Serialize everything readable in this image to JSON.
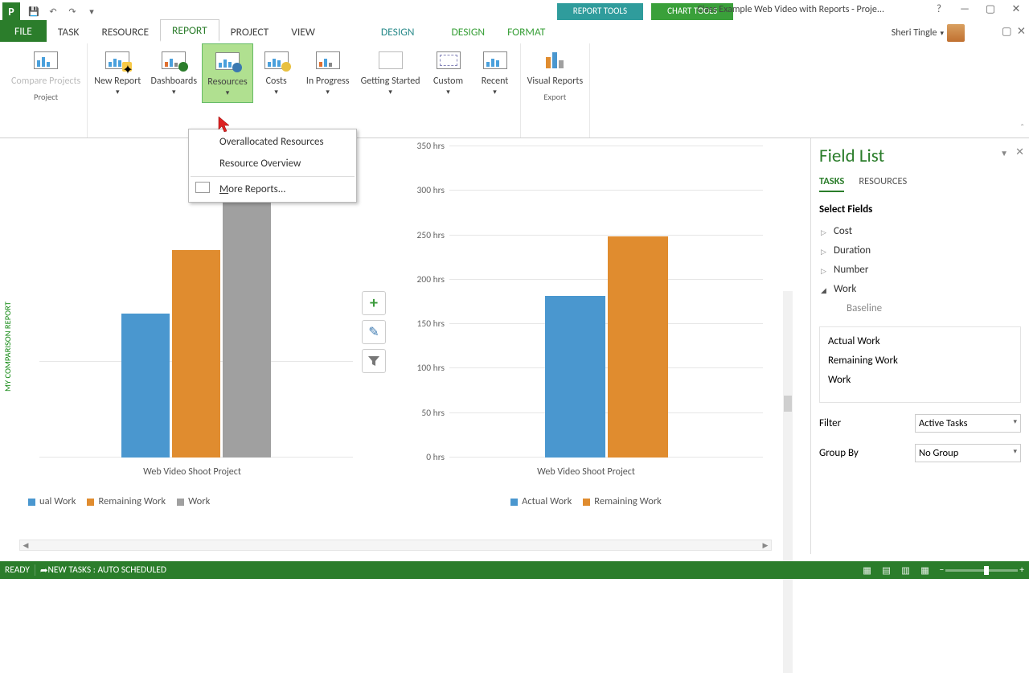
{
  "titlebar": {
    "doc_title": "Class Example Web Video with Reports - Proje...",
    "ctx_report": "REPORT TOOLS",
    "ctx_chart": "CHART TOOLS"
  },
  "tabs": {
    "file": "FILE",
    "task": "TASK",
    "resource": "RESOURCE",
    "report": "REPORT",
    "project": "PROJECT",
    "view": "VIEW",
    "design1": "DESIGN",
    "design2": "DESIGN",
    "format": "FORMAT",
    "user": "Sheri Tingle"
  },
  "ribbon": {
    "compare": "Compare\nProjects",
    "new_report": "New\nReport",
    "dashboards": "Dashboards",
    "resources": "Resources",
    "costs": "Costs",
    "in_progress": "In Progress",
    "getting_started": "Getting\nStarted",
    "custom": "Custom",
    "recent": "Recent",
    "visual": "Visual\nReports",
    "grp_project": "Project",
    "grp_export": "Export"
  },
  "dropdown": {
    "over": "Overallocated Resources",
    "overview": "Resource Overview",
    "more": "More Reports..."
  },
  "chart1": {
    "xaxis": "Web Video Shoot Project",
    "legend": [
      "ual Work",
      "Remaining Work",
      "Work"
    ]
  },
  "chart2": {
    "xaxis": "Web Video Shoot Project",
    "legend": [
      "Actual Work",
      "Remaining Work"
    ],
    "ylabels": [
      "0 hrs",
      "50 hrs",
      "100 hrs",
      "150 hrs",
      "200 hrs",
      "250 hrs",
      "300 hrs",
      "350 hrs"
    ]
  },
  "vtitle": "MY COMPARISON REPORT",
  "panel": {
    "title": "Field List",
    "tab_tasks": "TASKS",
    "tab_res": "RESOURCES",
    "select_fields": "Select Fields",
    "tree": {
      "cost": "Cost",
      "duration": "Duration",
      "number": "Number",
      "work": "Work",
      "baseline": "Baseline"
    },
    "sel": [
      "Actual Work",
      "Remaining Work",
      "Work"
    ],
    "filter_label": "Filter",
    "filter_value": "Active Tasks",
    "group_label": "Group By",
    "group_value": "No Group"
  },
  "status": {
    "ready": "READY",
    "newtasks": "NEW TASKS : AUTO SCHEDULED"
  },
  "chart_data": [
    {
      "type": "bar",
      "title": "",
      "categories": [
        "Web Video Shoot Project"
      ],
      "series": [
        {
          "name": "Actual Work",
          "values": [
            185
          ]
        },
        {
          "name": "Remaining Work",
          "values": [
            250
          ]
        },
        {
          "name": "Work",
          "values": [
            435
          ]
        }
      ],
      "ylabel": "hrs",
      "ylim": [
        0,
        450
      ],
      "note": "y-axis ticks not visible; heights estimated relative to chart 2"
    },
    {
      "type": "bar",
      "title": "",
      "categories": [
        "Web Video Shoot Project"
      ],
      "series": [
        {
          "name": "Actual Work",
          "values": [
            185
          ]
        },
        {
          "name": "Remaining Work",
          "values": [
            250
          ]
        }
      ],
      "ylabel": "hrs",
      "ylim": [
        0,
        350
      ]
    }
  ]
}
